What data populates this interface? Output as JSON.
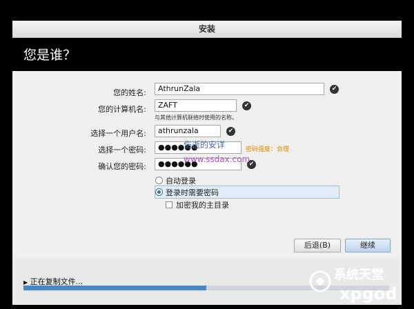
{
  "window": {
    "title": "安装"
  },
  "header": {
    "title": "您是谁？"
  },
  "form": {
    "name": {
      "label": "您的姓名:",
      "value": "AthrunZala"
    },
    "computer_name": {
      "label": "您的计算机名:",
      "value": "ZAFT",
      "hint": "与其他计算机联络时使用的名称。"
    },
    "username": {
      "label": "选择一个用户名:",
      "value": "athrunzala"
    },
    "password": {
      "label": "选择一个密码:",
      "value": "●●●●●●",
      "strength": "密码强度：合理"
    },
    "confirm": {
      "label": "确认您的密码:",
      "value": "●●●●●●"
    },
    "options": {
      "auto_login": "自动登录",
      "require_password": "登录时需要密码",
      "encrypt_home": "加密我的主目录"
    }
  },
  "buttons": {
    "back": "后退(B)",
    "continue": "继续"
  },
  "progress": {
    "label": "正在复制文件...",
    "fraction": 0.5
  },
  "watermark": {
    "line1": "伤逝的安详",
    "line2": "www.ssdax.com"
  },
  "logo": {
    "text": "系统天堂",
    "latin": "xpgod"
  },
  "icons": {
    "check": "check-circle-icon",
    "arrow": "triangle-right-icon"
  },
  "colors": {
    "accent": "#4a86c5",
    "strength": "#e08a00",
    "continue_btn": "#cfe0f3"
  }
}
